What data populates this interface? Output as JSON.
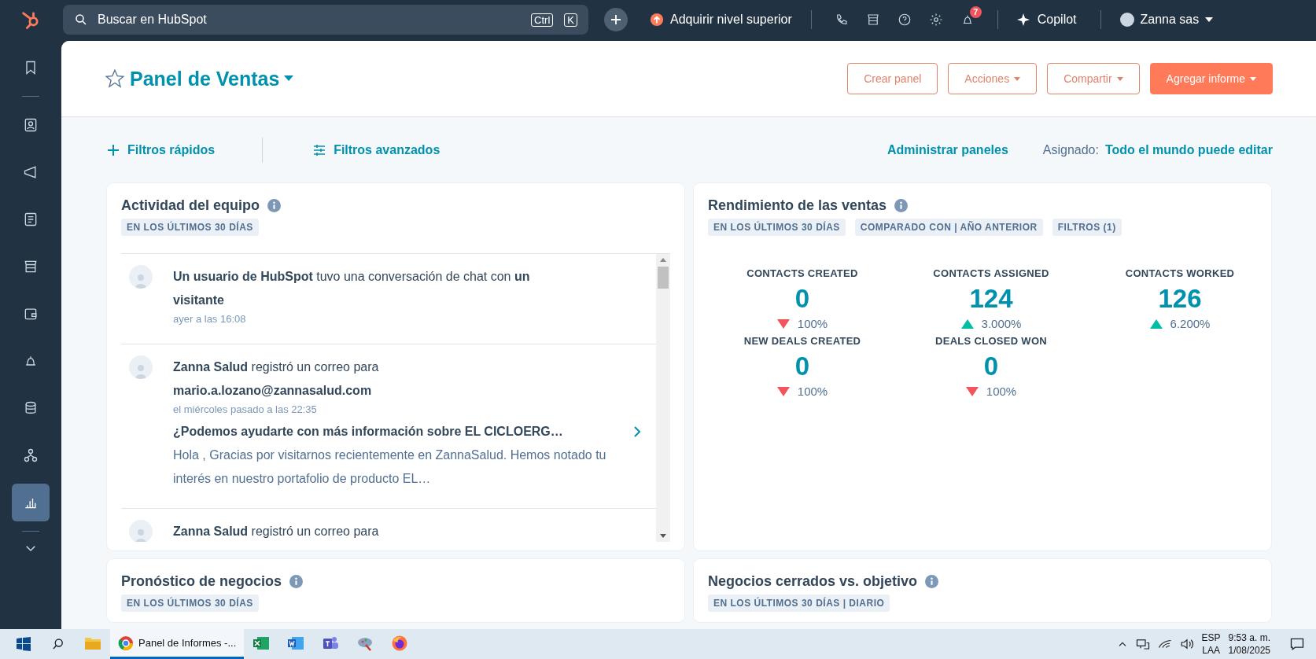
{
  "topbar": {
    "search": {
      "placeholder": "Buscar en HubSpot"
    },
    "shortcut_keys": [
      "Ctrl",
      "K"
    ],
    "upgrade": "Adquirir nivel superior",
    "notifications_count": "7",
    "copilot": "Copilot",
    "account": "Zanna sas"
  },
  "sidebar": {
    "items": [
      {
        "selected": false
      },
      {
        "selected": false
      },
      {
        "selected": false
      },
      {
        "selected": false
      },
      {
        "selected": false
      },
      {
        "selected": false
      },
      {
        "selected": false
      },
      {
        "selected": false
      },
      {
        "selected": false
      },
      {
        "selected": true
      }
    ]
  },
  "header": {
    "title": "Panel de Ventas",
    "buttons": [
      {
        "label": "Crear panel",
        "kind": "outline",
        "dropdown": false
      },
      {
        "label": "Acciones",
        "kind": "outline",
        "dropdown": true
      },
      {
        "label": "Compartir",
        "kind": "outline",
        "dropdown": true
      },
      {
        "label": "Agregar informe",
        "kind": "primary",
        "dropdown": true
      }
    ]
  },
  "filters": {
    "quick": "Filtros rápidos",
    "advanced": "Filtros avanzados",
    "manage": "Administrar paneles",
    "assigned_label": "Asignado:",
    "assigned_value": "Todo el mundo puede editar"
  },
  "team_activity": {
    "title": "Actividad del equipo",
    "tags": [
      "EN LOS ÚLTIMOS 30 DÍAS"
    ],
    "items": [
      {
        "summary": "**Un usuario de HubSpot** tuvo una conversación de chat con **un visitante**",
        "time": "ayer a las 16:08"
      },
      {
        "summary": "**Zanna Salud** registró un correo para **mario.a.lozano@zannasalud.com**",
        "time": "el miércoles pasado a las 22:35",
        "subject": "¿Podemos ayudarte con más información sobre EL CICLOERG…",
        "preview": "Hola ,   Gracias por visitarnos recientemente en ZannaSalud. Hemos notado tu interés en nuestro portafolio de producto EL…"
      },
      {
        "summary": "**Zanna Salud** registró un correo para"
      }
    ]
  },
  "sales_performance": {
    "title": "Rendimiento de las ventas",
    "tags": [
      "EN LOS ÚLTIMOS 30 DÍAS",
      "COMPARADO CON | AÑO ANTERIOR",
      "FILTROS (1)"
    ],
    "metrics": [
      {
        "label": "CONTACTS CREATED",
        "value": "0",
        "change": "100%",
        "increase": false
      },
      {
        "label": "CONTACTS ASSIGNED",
        "value": "124",
        "change": "3.000%",
        "increase": true
      },
      {
        "label": "CONTACTS WORKED",
        "value": "126",
        "change": "6.200%",
        "increase": true
      },
      {
        "label": "NEW DEALS CREATED",
        "value": "0",
        "change": "100%",
        "increase": false
      },
      {
        "label": "DEALS CLOSED WON",
        "value": "0",
        "change": "100%",
        "increase": false
      }
    ]
  },
  "bottom_cards": [
    {
      "title": "Pronóstico de negocios",
      "tags": [
        "EN LOS ÚLTIMOS 30 DÍAS"
      ]
    },
    {
      "title": "Negocios cerrados vs. objetivo",
      "tags": [
        "EN LOS ÚLTIMOS 30 DÍAS | DIARIO"
      ]
    }
  ],
  "taskbar": {
    "apps": [
      {
        "active": false
      },
      {
        "label": "Panel de Informes -...",
        "active": true
      },
      {
        "active": false
      },
      {
        "active": false
      },
      {
        "active": false
      },
      {
        "active": false
      },
      {
        "active": false
      }
    ],
    "language": "ESP",
    "layout": "LAA",
    "time": "9:53 a. m.",
    "date": "1/08/2025"
  }
}
